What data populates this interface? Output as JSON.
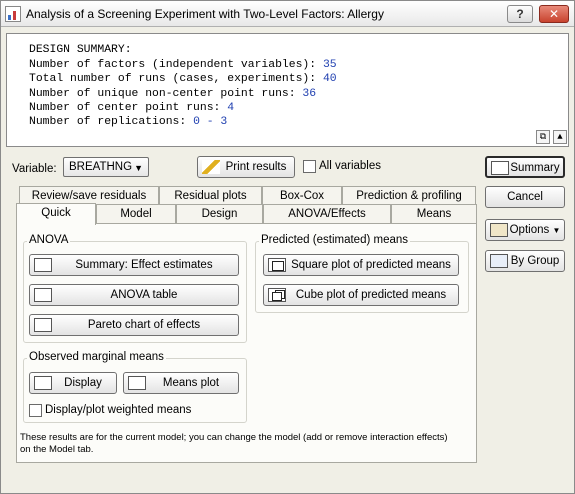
{
  "window": {
    "title": "Analysis of a Screening Experiment with Two-Level Factors: Allergy",
    "help_label": "?",
    "close_label": "✕"
  },
  "output": {
    "heading": "DESIGN SUMMARY:",
    "lines": [
      {
        "label": "Number of factors (independent variables): ",
        "value": "35"
      },
      {
        "label": "Total number of runs (cases, experiments): ",
        "value": "40"
      },
      {
        "label": "Number of unique non-center point runs: ",
        "value": "36"
      },
      {
        "label": "Number of center point runs: ",
        "value": "4"
      },
      {
        "label": "Number of replications: ",
        "value": "0 - 3"
      }
    ]
  },
  "variable": {
    "label": "Variable:",
    "selected": "BREATHNG"
  },
  "print_results_label": "Print results",
  "all_variables_label": "All variables",
  "side_buttons": {
    "summary": "Summary",
    "cancel": "Cancel",
    "options": "Options",
    "by_group": "By Group"
  },
  "tabs": {
    "row_back": [
      "Review/save residuals",
      "Residual plots",
      "Box-Cox",
      "Prediction & profiling"
    ],
    "row_front": [
      "Quick",
      "Model",
      "Design",
      "ANOVA/Effects",
      "Means"
    ]
  },
  "anova_group": {
    "title": "ANOVA",
    "summary_effect_estimates": "Summary: Effect estimates",
    "anova_table": "ANOVA table",
    "pareto_chart": "Pareto chart of effects"
  },
  "predicted_group": {
    "title": "Predicted (estimated) means",
    "square_plot": "Square plot of predicted means",
    "cube_plot": "Cube plot of predicted means"
  },
  "observed_group": {
    "title": "Observed marginal means",
    "display": "Display",
    "means_plot": "Means plot",
    "weighted_label": "Display/plot weighted means"
  },
  "note": {
    "line1": "These results are for the current model; you can change the model (add or remove interaction effects)",
    "line2": "on the Model tab."
  }
}
